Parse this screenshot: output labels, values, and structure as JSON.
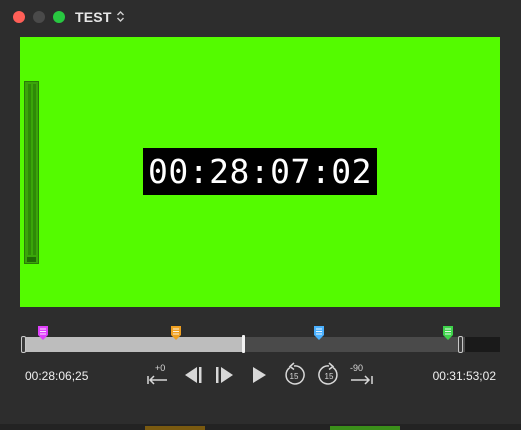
{
  "window": {
    "title": "TEST"
  },
  "viewer": {
    "timecode": "00:28:07:02",
    "background_color": "#54fb00"
  },
  "timeline": {
    "progress_fraction": 0.46,
    "markers": [
      {
        "color": "#e040fb",
        "position_fraction": 0.04
      },
      {
        "color": "#f0a020",
        "position_fraction": 0.32
      },
      {
        "color": "#4ab0ff",
        "position_fraction": 0.62
      },
      {
        "color": "#3ed34a",
        "position_fraction": 0.89
      }
    ]
  },
  "transport": {
    "current_time": "00:28:06;25",
    "duration": "00:31:53;02",
    "jump_back_label": "+0",
    "skip_back_label": "15",
    "skip_forward_label": "15",
    "jump_forward_label": "-90",
    "icons": [
      "go-to-start-icon",
      "previous-frame-icon",
      "next-frame-icon",
      "play-icon",
      "skip-back-15-icon",
      "skip-forward-15-icon",
      "go-to-end-icon"
    ]
  }
}
